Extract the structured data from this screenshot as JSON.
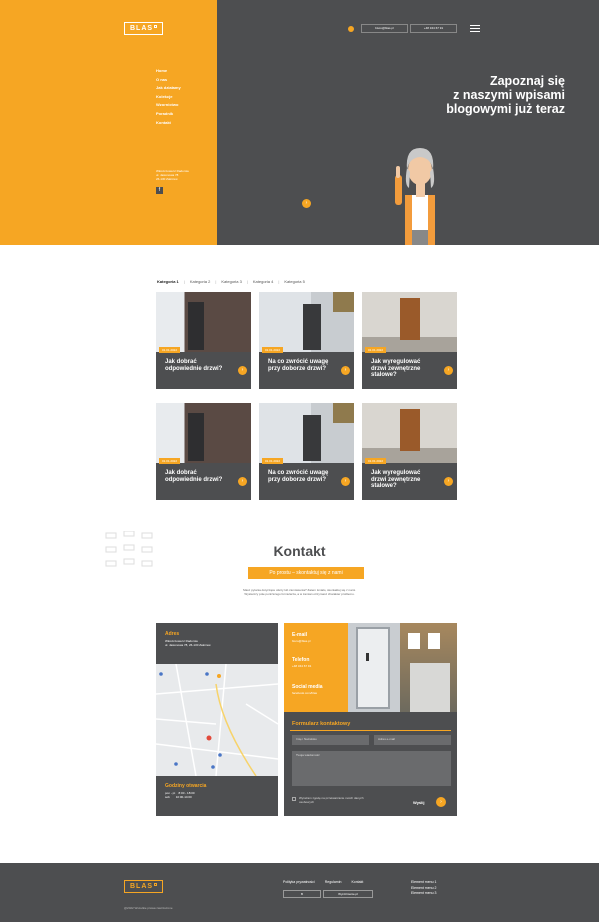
{
  "brand": {
    "logo": "BLAS"
  },
  "header": {
    "email": "biuro@blas.pl",
    "phone": "+48 344 67 91",
    "menu_icon": "hamburger-icon"
  },
  "nav": {
    "items": [
      "Home",
      "O nas",
      "Jak działamy",
      "Kolekcje",
      "Wzornictwo",
      "Poradnik",
      "Kontakt"
    ]
  },
  "hero_address": [
    "Włoszczowa k/ Radomia",
    "ul. Jasionowa 78",
    "26-130 Zakrzew"
  ],
  "social": {
    "facebook_icon": "facebook-icon",
    "label": "f"
  },
  "hero": {
    "title_line1": "Zapoznaj się",
    "title_line2": "z naszymi wpisami",
    "title_line3": "blogowymi już teraz"
  },
  "categories": [
    "Kategoria 1",
    "Kategoria 2",
    "Kategoria 3",
    "Kategoria 4",
    "Kategoria 5"
  ],
  "cards": [
    {
      "date": "01.01.2022",
      "title": "Jak dobrać odpowiednie drzwi?"
    },
    {
      "date": "01.01.2022",
      "title": "Na co zwrócić uwagę przy doborze drzwi?"
    },
    {
      "date": "01.01.2022",
      "title": "Jak wyregulować drzwi zewnętrzne stalowe?"
    },
    {
      "date": "01.01.2022",
      "title": "Jak dobrać odpowiednie drzwi?"
    },
    {
      "date": "01.01.2022",
      "title": "Na co zwrócić uwagę przy doborze drzwi?"
    },
    {
      "date": "01.01.2022",
      "title": "Jak wyregulować drzwi zewnętrzne stalowe?"
    }
  ],
  "contact": {
    "title": "Kontakt",
    "cta": "Po prostu – skontaktuj się z nami",
    "desc1": "Masz pytania dotyczące oferty lub zamówienia? Zatem śmiało, skontaktuj się z nami.",
    "desc2": "Wystarczy pole poniższego formularza, a w zamian otrzymasz charakter problemu.",
    "address_title": "Adres",
    "address_l1": "Włoszczowa k/ Radomia",
    "address_l2": "ul. Jasionowa 78, 26-130 Zakrzew",
    "hours_title": "Godziny otwarcia",
    "hours_l1_day": "pon - pt",
    "hours_l1": "8:00 - 18:00",
    "hours_l2_day": "sob",
    "hours_l2": "10:00-14:00",
    "email_title": "E-mail",
    "email": "biuro@blas.pl",
    "phone_title": "Telefon",
    "phone": "+48 344 67 91",
    "social_title": "Social media",
    "social": "facebook.com/blas",
    "form_title": "Formularz kontaktowy",
    "ph_name": "Imię i Nazwisko",
    "ph_email": "Adres e-mail",
    "ph_message": "Twoja wiadomość",
    "consent": "Wyrażam zgodę na przetwarzanie moich danych osobowych",
    "submit": "Wyślij"
  },
  "footer": {
    "copyright": "@2022 Wszelkie prawa zastrzeżone",
    "links": [
      "Polityka prywatności",
      "Regulamin",
      "Kontakt"
    ],
    "box1": "B",
    "box2": "Wyróżnienie.pl",
    "menu": [
      "Element menu 1",
      "Element menu 2",
      "Element menu 3"
    ]
  },
  "colors": {
    "accent": "#f6a623",
    "dark": "#4d4e50"
  }
}
